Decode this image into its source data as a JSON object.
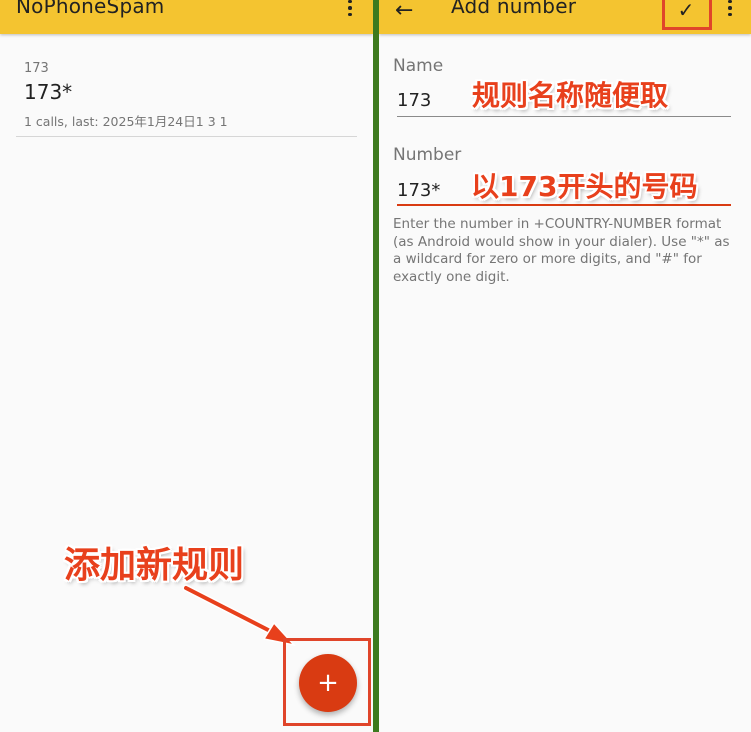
{
  "left_screen": {
    "app_title": "NoPhoneSpam",
    "list": [
      {
        "subtitle": "173",
        "title": "173*",
        "meta": "1 calls, last: 2025年1月24日1 3  1"
      }
    ],
    "fab_label": "+"
  },
  "right_screen": {
    "back_icon": "←",
    "title": "Add number",
    "confirm_icon": "✓",
    "name_label": "Name",
    "name_value": "173",
    "number_label": "Number",
    "number_value": "173*",
    "help_text": "Enter the number in +COUNTRY-NUMBER format (as Android would show in your dialer). Use \"*\" as a wildcard for zero or more digits, and \"#\" for exactly one digit."
  },
  "annotations": {
    "name_hint": "规则名称随便取",
    "number_hint": "以173开头的号码",
    "add_rule_hint": "添加新规则"
  },
  "colors": {
    "appbar": "#f4c430",
    "accent": "#d93b12",
    "annotation": "#e8401c",
    "divider": "#3d7a1e"
  },
  "icons": {
    "overflow": "more-vert-icon",
    "back": "arrow-back-icon",
    "confirm": "check-icon",
    "add": "plus-icon"
  }
}
